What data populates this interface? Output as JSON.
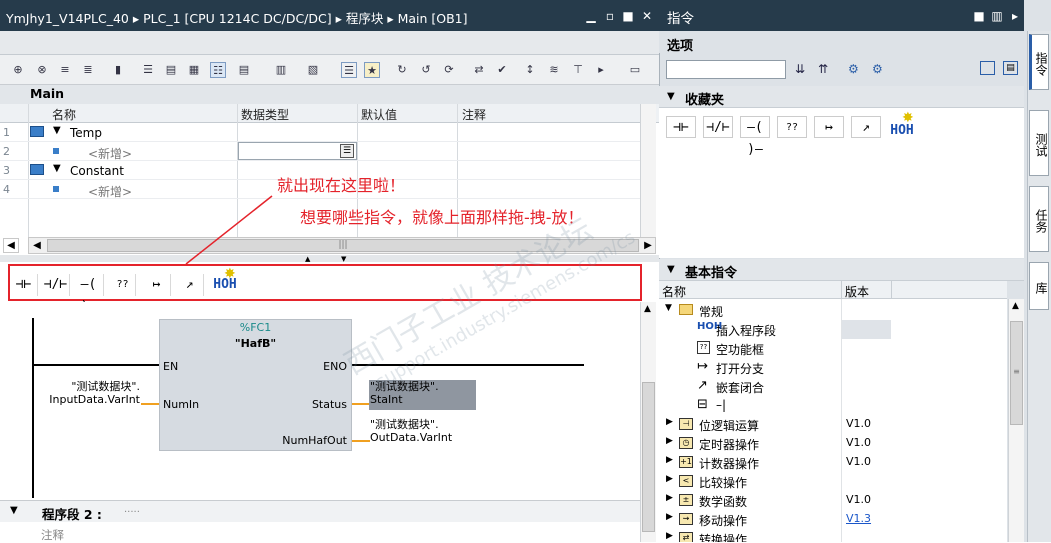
{
  "titlebar": {
    "breadcrumb": "YmJhy1_V14PLC_40  ▸  PLC_1 [CPU 1214C DC/DC/DC]  ▸  程序块  ▸  Main [OB1]"
  },
  "block": {
    "name": "Main"
  },
  "table": {
    "headers": [
      "名称",
      "数据类型",
      "默认值",
      "注释"
    ],
    "rows": [
      {
        "num": "1",
        "name": "Temp"
      },
      {
        "num": "2",
        "name": "<新增>"
      },
      {
        "num": "3",
        "name": "Constant"
      },
      {
        "num": "4",
        "name": "<新增>"
      }
    ]
  },
  "ladder_palette": [
    "⊣⊢",
    "⊣/⊢",
    "–( )–",
    "??",
    "↦",
    "↗",
    "HOH"
  ],
  "annotations": {
    "line1": "就出现在这里啦！",
    "line2": "想要哪些指令，就像上面那样拖-拽-放！"
  },
  "network1": {
    "fc_number": "%FC1",
    "fc_name": "\"HafB\"",
    "en": "EN",
    "eno": "ENO",
    "in_label": "\"测试数据块\".\nInputData.VarInt",
    "in_pin": "NumIn",
    "status_pin": "Status",
    "status_label": "\"测试数据块\".\nStaInt",
    "out_pin": "NumHafOut",
    "out_label": "\"测试数据块\".\nOutData.VarInt"
  },
  "network2": {
    "title": "程序段 2 :",
    "dots": ".....",
    "comment": "注释"
  },
  "right": {
    "title": "指令",
    "options": "选项",
    "favorites": "收藏夹",
    "basic": "基本指令",
    "col_name": "名称",
    "col_version": "版本",
    "folder_general": "常规",
    "general_items": [
      "插入程序段",
      "空功能框",
      "打开分支",
      "嵌套闭合",
      "–|"
    ],
    "categories": [
      {
        "name": "位逻辑运算",
        "version": "V1.0"
      },
      {
        "name": "定时器操作",
        "version": "V1.0"
      },
      {
        "name": "计数器操作",
        "version": "V1.0"
      },
      {
        "name": "比较操作",
        "version": ""
      },
      {
        "name": "数学函数",
        "version": "V1.0"
      },
      {
        "name": "移动操作",
        "version": "V1.3"
      },
      {
        "name": "转换操作",
        "version": ""
      }
    ],
    "tabs": [
      "指令",
      "测试",
      "任务",
      "库"
    ]
  },
  "watermark": {
    "text1": "西门子工业 技术论坛",
    "text2": "support.industry.siemens.com/cs"
  },
  "colors": {
    "titlebar": "#263b4b",
    "highlight": "#e4232b",
    "fcblock": "#d6dbe1",
    "statusbox": "#8f96a0",
    "link": "#1a56c9"
  }
}
